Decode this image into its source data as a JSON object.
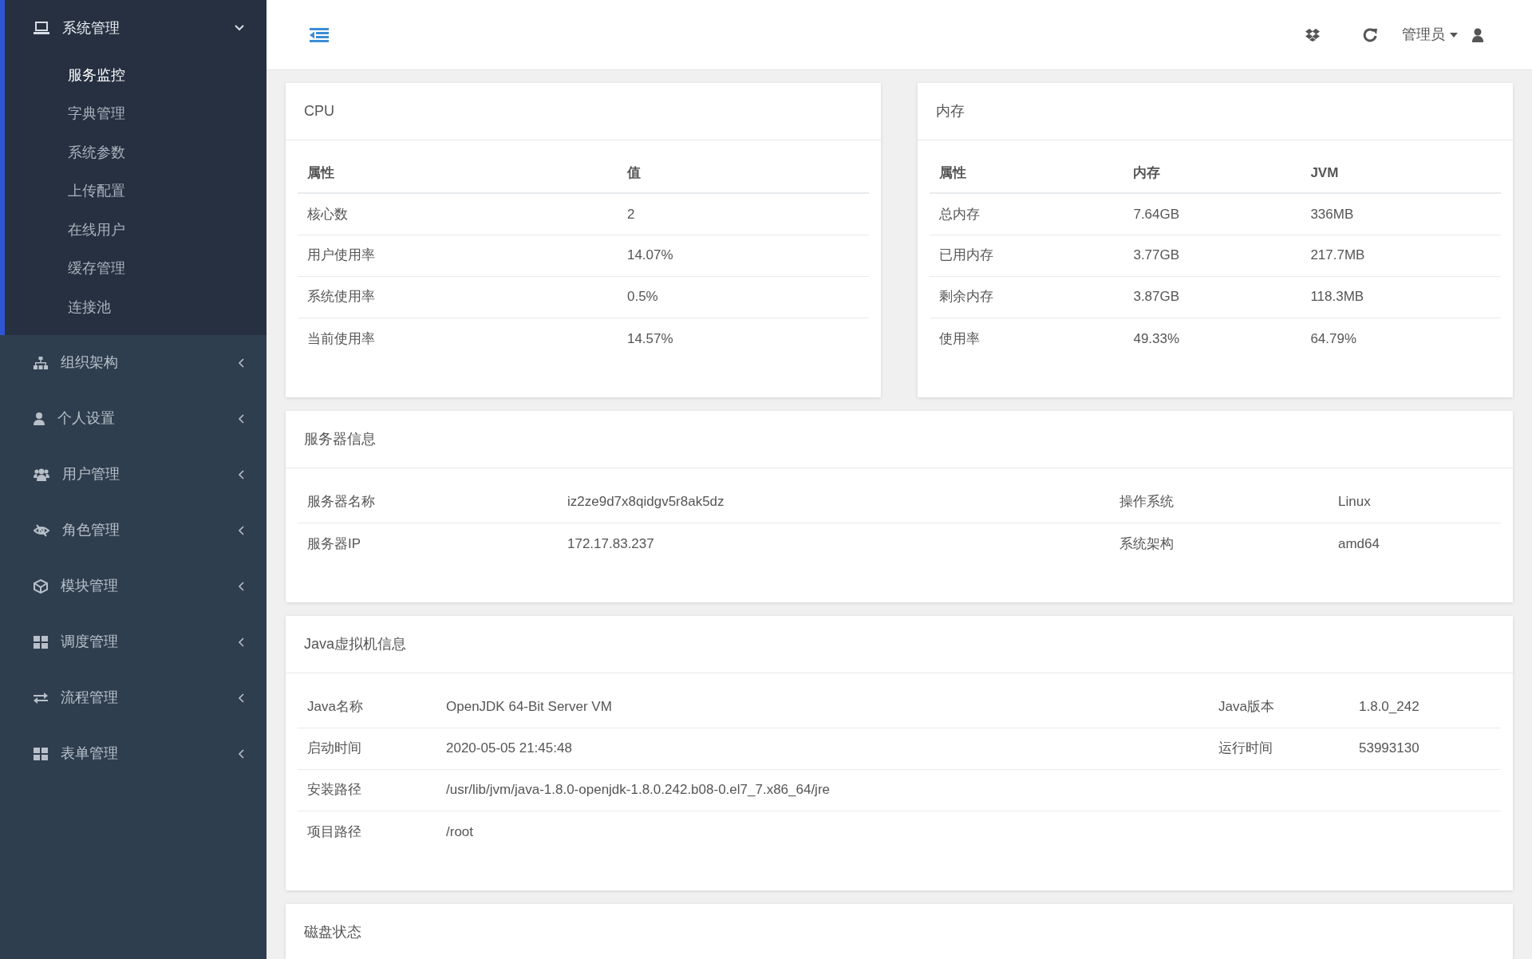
{
  "sidebar": {
    "menus": [
      {
        "label": "系统管理",
        "expanded": true,
        "children": [
          {
            "label": "服务监控",
            "selected": true
          },
          {
            "label": "字典管理",
            "selected": false
          },
          {
            "label": "系统参数",
            "selected": false
          },
          {
            "label": "上传配置",
            "selected": false
          },
          {
            "label": "在线用户",
            "selected": false
          },
          {
            "label": "缓存管理",
            "selected": false
          },
          {
            "label": "连接池",
            "selected": false
          }
        ]
      },
      {
        "label": "组织架构",
        "expanded": false
      },
      {
        "label": "个人设置",
        "expanded": false
      },
      {
        "label": "用户管理",
        "expanded": false
      },
      {
        "label": "角色管理",
        "expanded": false
      },
      {
        "label": "模块管理",
        "expanded": false
      },
      {
        "label": "调度管理",
        "expanded": false
      },
      {
        "label": "流程管理",
        "expanded": false
      },
      {
        "label": "表单管理",
        "expanded": false
      }
    ]
  },
  "header": {
    "user": "管理员"
  },
  "cpu": {
    "title": "CPU",
    "columns": [
      "属性",
      "值"
    ],
    "rows": [
      [
        "核心数",
        "2"
      ],
      [
        "用户使用率",
        "14.07%"
      ],
      [
        "系统使用率",
        "0.5%"
      ],
      [
        "当前使用率",
        "14.57%"
      ]
    ]
  },
  "memory": {
    "title": "内存",
    "columns": [
      "属性",
      "内存",
      "JVM"
    ],
    "rows": [
      [
        "总内存",
        "7.64GB",
        "336MB"
      ],
      [
        "已用内存",
        "3.77GB",
        "217.7MB"
      ],
      [
        "剩余内存",
        "3.87GB",
        "118.3MB"
      ],
      [
        "使用率",
        "49.33%",
        "64.79%"
      ]
    ]
  },
  "server_info": {
    "title": "服务器信息",
    "rows": [
      [
        "服务器名称",
        "iz2ze9d7x8qidgv5r8ak5dz",
        "操作系统",
        "Linux"
      ],
      [
        "服务器IP",
        "172.17.83.237",
        "系统架构",
        "amd64"
      ]
    ]
  },
  "java_info": {
    "title": "Java虚拟机信息",
    "rows": [
      [
        "Java名称",
        "OpenJDK 64-Bit Server VM",
        "Java版本",
        "1.8.0_242"
      ],
      [
        "启动时间",
        "2020-05-05 21:45:48",
        "运行时间",
        "53993130"
      ],
      [
        "安装路径",
        "/usr/lib/jvm/java-1.8.0-openjdk-1.8.0.242.b08-0.el7_7.x86_64/jre"
      ],
      [
        "项目路径",
        "/root"
      ]
    ]
  },
  "disk": {
    "title": "磁盘状态"
  }
}
